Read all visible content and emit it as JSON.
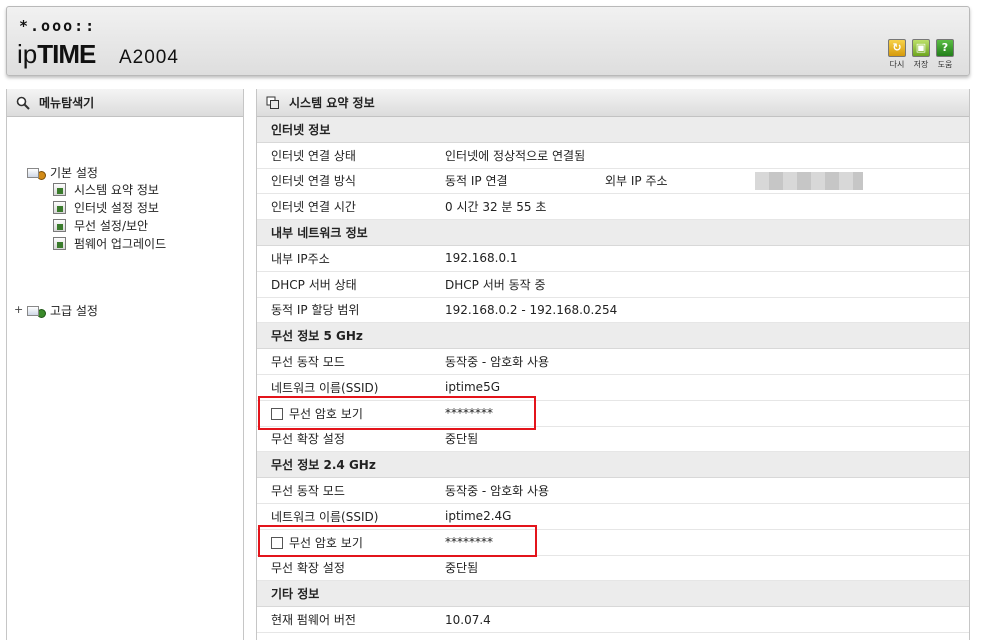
{
  "header": {
    "brand_mark": "*.ooo::",
    "brand_ip": "ip",
    "brand_time": "TIME",
    "model": "A2004",
    "tools": [
      {
        "icon": "refresh-icon",
        "glyph": "↻",
        "label": "다시"
      },
      {
        "icon": "save-icon",
        "glyph": "▣",
        "label": "저장"
      },
      {
        "icon": "help-icon",
        "glyph": "?",
        "label": "도움"
      }
    ]
  },
  "left_panel": {
    "title": "메뉴탐색기",
    "basic_group": "기본 설정",
    "items": [
      "시스템 요약 정보",
      "인터넷 설정 정보",
      "무선 설정/보안",
      "펌웨어 업그레이드"
    ],
    "advanced_group": "고급 설정",
    "expand_symbol": "+"
  },
  "right_panel": {
    "title": "시스템 요약 정보",
    "internet": {
      "section": "인터넷 정보",
      "status_label": "인터넷 연결 상태",
      "status_value": "인터넷에 정상적으로 연결됨",
      "method_label": "인터넷 연결 방식",
      "method_value": "동적 IP 연결",
      "external_ip_label": "외부 IP 주소",
      "time_label": "인터넷 연결 시간",
      "time_value": "0 시간 32 분 55 초"
    },
    "lan": {
      "section": "내부 네트워크 정보",
      "ip_label": "내부 IP주소",
      "ip_value": "192.168.0.1",
      "dhcp_label": "DHCP 서버 상태",
      "dhcp_value": "DHCP 서버 동작 중",
      "range_label": "동적 IP 할당 범위",
      "range_value": "192.168.0.2 -  192.168.0.254"
    },
    "wifi5": {
      "section": "무선 정보 5 GHz",
      "mode_label": "무선 동작 모드",
      "mode_value": "동작중 - 암호화 사용",
      "ssid_label": "네트워크 이름(SSID)",
      "ssid_value": "iptime5G",
      "show_pw_label": "무선 암호 보기",
      "pw_value": "********",
      "ext_label": "무선 확장 설정",
      "ext_value": "중단됨"
    },
    "wifi24": {
      "section": "무선 정보 2.4 GHz",
      "mode_label": "무선 동작 모드",
      "mode_value": "동작중 - 암호화 사용",
      "ssid_label": "네트워크 이름(SSID)",
      "ssid_value": "iptime2.4G",
      "show_pw_label": "무선 암호 보기",
      "pw_value": "********",
      "ext_label": "무선 확장 설정",
      "ext_value": "중단됨"
    },
    "other": {
      "section": "기타 정보",
      "fw_label": "현재 펌웨어 버전",
      "fw_value": "10.07.4"
    }
  },
  "colors": {
    "highlight": "#e3141b",
    "section_bg": "#ececec"
  }
}
